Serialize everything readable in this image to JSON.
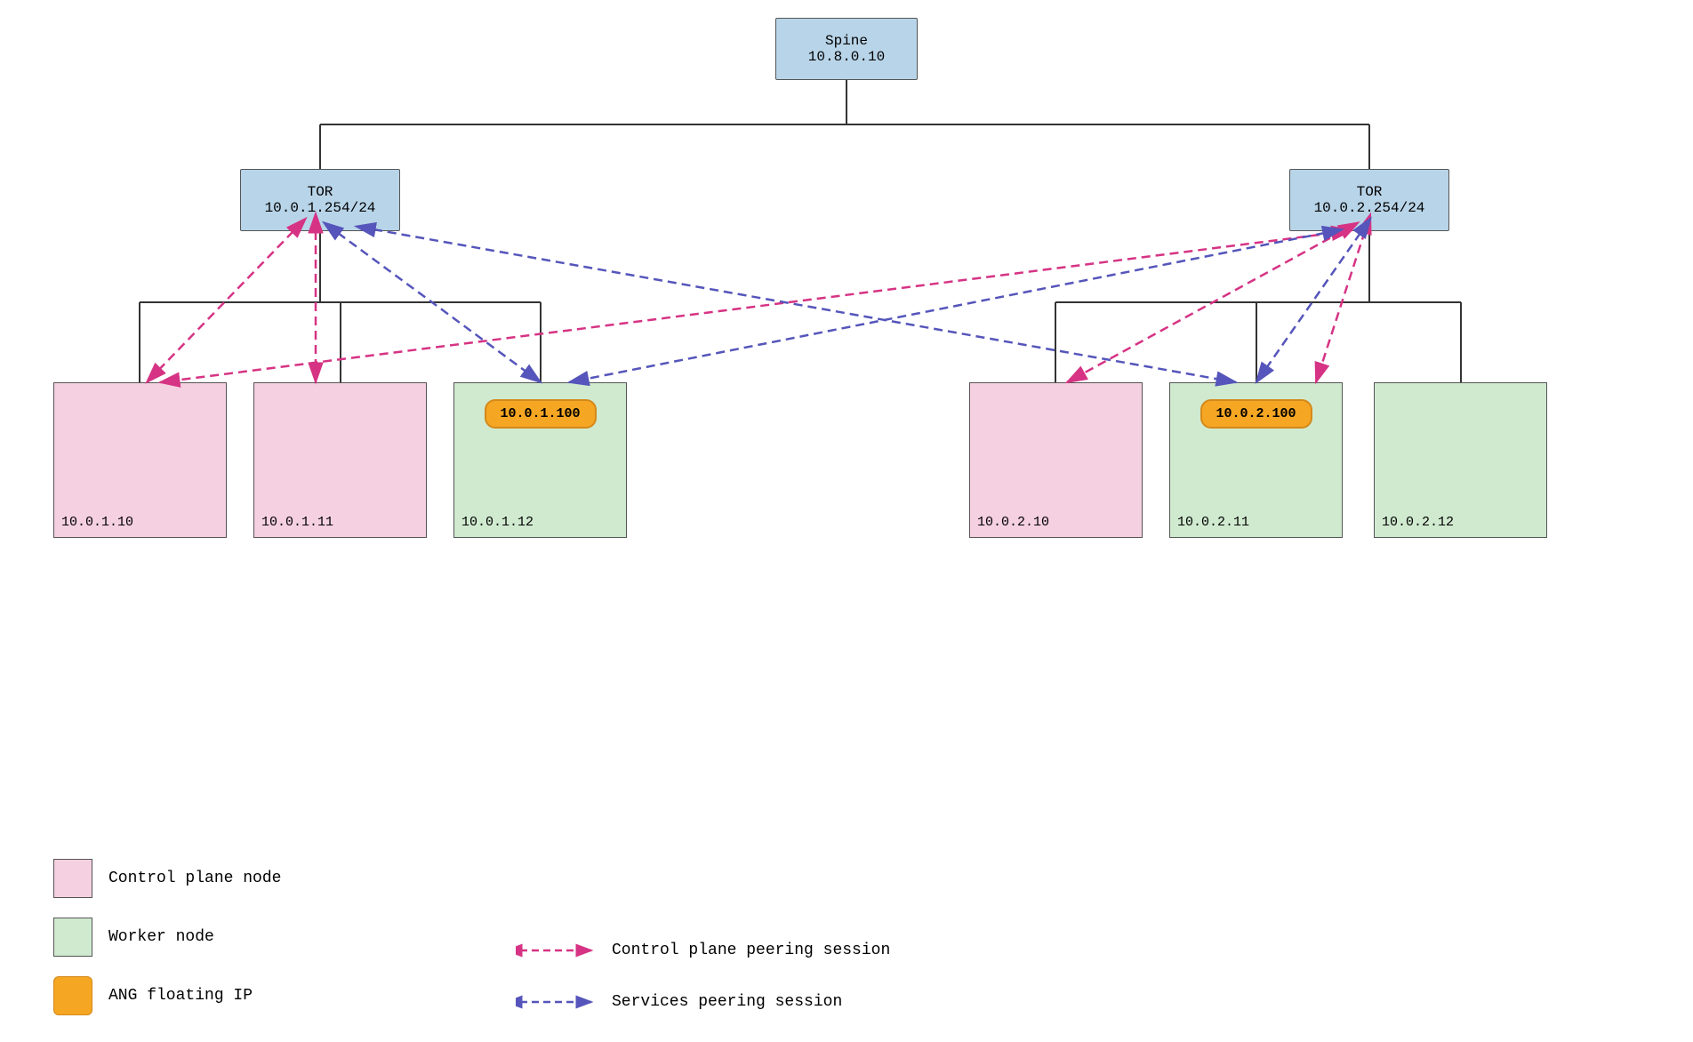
{
  "nodes": {
    "spine": {
      "label": "Spine",
      "ip": "10.8.0.10"
    },
    "tor_left": {
      "label": "TOR",
      "ip": "10.0.1.254/24"
    },
    "tor_right": {
      "label": "TOR",
      "ip": "10.0.2.254/24"
    },
    "servers": [
      {
        "id": "s1",
        "ip": "10.0.1.10",
        "type": "control"
      },
      {
        "id": "s2",
        "ip": "10.0.1.11",
        "type": "control"
      },
      {
        "id": "s3",
        "ip": "10.0.1.12",
        "type": "worker",
        "floating_ip": "10.0.1.100"
      },
      {
        "id": "s4",
        "ip": "10.0.2.10",
        "type": "control"
      },
      {
        "id": "s5",
        "ip": "10.0.2.11",
        "type": "worker",
        "floating_ip": "10.0.2.100"
      },
      {
        "id": "s6",
        "ip": "10.0.2.12",
        "type": "worker"
      }
    ]
  },
  "legend": {
    "control_plane_node": "Control plane node",
    "worker_node": "Worker node",
    "ang_floating_ip": "ANG floating IP",
    "control_plane_peering": "Control plane peering session",
    "services_peering": "Services peering session"
  }
}
